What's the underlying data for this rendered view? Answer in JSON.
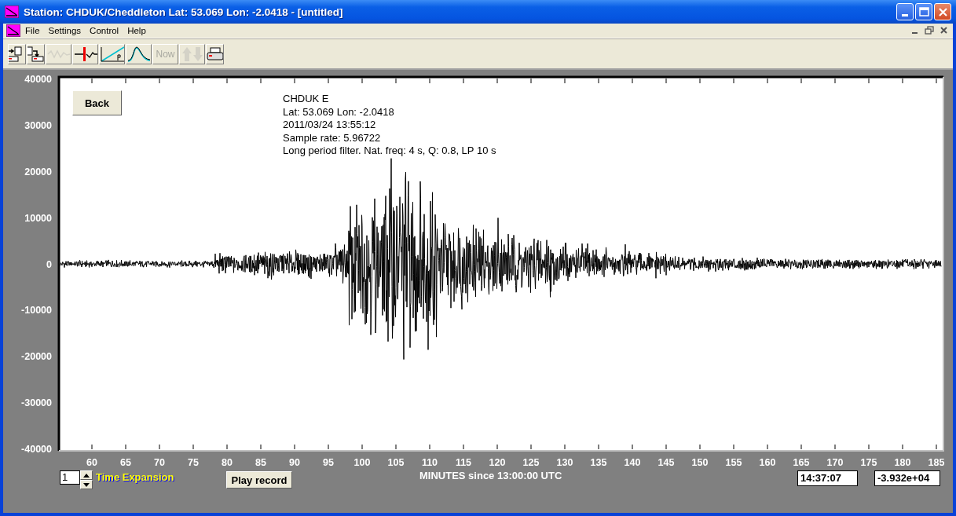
{
  "window": {
    "title": "Station: CHDUK/Cheddleton Lat: 53.069 Lon: -2.0418 - [untitled]"
  },
  "menu": [
    "File",
    "Settings",
    "Control",
    "Help"
  ],
  "toolbar": [
    {
      "kind": "open-doc",
      "disabled": false
    },
    {
      "kind": "save-doc",
      "disabled": false
    },
    {
      "kind": "wave",
      "disabled": true
    },
    {
      "kind": "marker",
      "disabled": false
    },
    {
      "kind": "ramp",
      "disabled": false
    },
    {
      "kind": "peak",
      "disabled": false
    },
    {
      "kind": "text",
      "label": "Now",
      "disabled": true
    },
    {
      "kind": "updown",
      "disabled": true
    },
    {
      "kind": "print",
      "disabled": false
    }
  ],
  "plot": {
    "back_button": "Back",
    "info": [
      "CHDUK  E",
      "Lat: 53.069 Lon: -2.0418",
      "2011/03/24 13:55:12",
      "Sample rate: 5.96722",
      "Long period filter. Nat. freq: 4 s, Q: 0.8, LP 10 s"
    ],
    "yticks": [
      "40000",
      "30000",
      "20000",
      "10000",
      "0",
      "-10000",
      "-20000",
      "-30000",
      "-40000"
    ],
    "xticks": [
      "60",
      "65",
      "70",
      "75",
      "80",
      "85",
      "90",
      "95",
      "100",
      "105",
      "110",
      "115",
      "120",
      "125",
      "130",
      "135",
      "140",
      "145",
      "150",
      "155",
      "160",
      "165",
      "170",
      "175",
      "180",
      "185"
    ],
    "xlabel": "MINUTES since 13:00:00 UTC"
  },
  "bottom": {
    "expansion_value": "1",
    "expansion_label": "Time Expansion",
    "play_button": "Play record",
    "time_field": "14:37:07",
    "value_field": "-3.932e+04"
  }
}
